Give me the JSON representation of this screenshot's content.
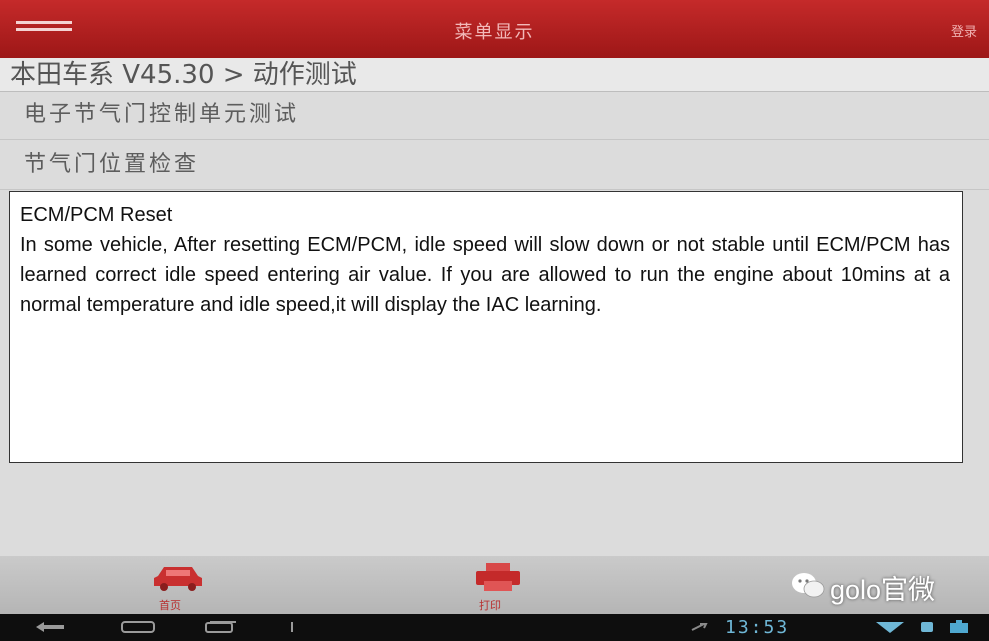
{
  "header": {
    "title": "菜单显示",
    "right_action": "登录"
  },
  "breadcrumb": "本田车系 V45.30 > 动作测试",
  "menu_items": [
    "电子节气门控制单元测试",
    "节气门位置检查"
  ],
  "info_box": {
    "title": "ECM/PCM Reset",
    "body": "In some vehicle, After resetting ECM/PCM, idle speed will slow down or not stable until ECM/PCM has learned correct idle speed entering air value. If you are allowed to run the engine about 10mins at a normal temperature and idle speed,it will display the IAC learning."
  },
  "bottom_nav": [
    {
      "label": "首页",
      "icon": "car-icon"
    },
    {
      "label": "打印",
      "icon": "printer-icon"
    }
  ],
  "watermark": "golo官微",
  "system_bar": {
    "time": "13:53"
  },
  "colors": {
    "header_red": "#b52222",
    "accent_red": "#c42a2a",
    "clock_blue": "#6fb7d6"
  }
}
